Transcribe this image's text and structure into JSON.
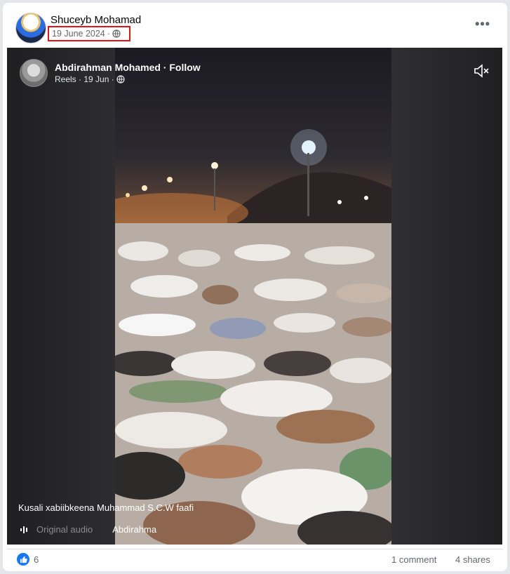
{
  "post": {
    "author": "Shuceyb Mohamad",
    "date": "19 June 2024",
    "separator": "·",
    "more_label": "•••"
  },
  "reel": {
    "author": "Abdirahman Mohamed · Follow",
    "meta": "Reels · 19 Jun ·",
    "caption": "Kusali xabiibkeena Muhammad S.C.W faafi",
    "audio": "Original audio",
    "uploader": "Abdirahma"
  },
  "footer": {
    "reaction_count": "6",
    "comments": "1 comment",
    "shares": "4 shares"
  },
  "colors": {
    "highlight": "#e0151a",
    "like_blue": "#1877f2",
    "video_bg": "#2a2a2c"
  },
  "icons": [
    "globe-icon",
    "more-options-icon",
    "mute-icon",
    "audio-wave-icon",
    "like-icon"
  ]
}
